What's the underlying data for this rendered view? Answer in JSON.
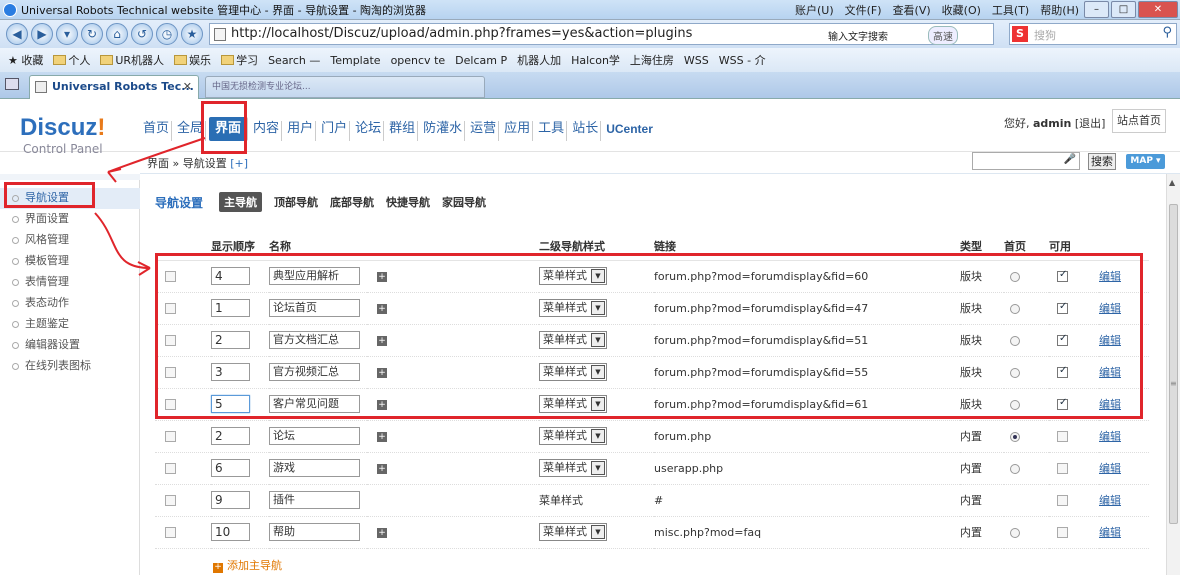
{
  "browser": {
    "title": "Universal Robots Technical website 管理中心 - 界面 - 导航设置 - 陶淘的浏览器",
    "menu": [
      "账户(U)",
      "文件(F)",
      "查看(V)",
      "收藏(O)",
      "工具(T)",
      "帮助(H)"
    ],
    "url": "http://localhost/Discuz/upload/admin.php?frames=yes&action=plugins",
    "ime_hint": "输入文字搜索",
    "speed_label": "高速",
    "search_placeholder": "搜狗",
    "bookmarks": [
      "收藏",
      "个人",
      "UR机器人",
      "娱乐",
      "学习",
      "Search —",
      "Template",
      "opencv te",
      "Delcam P",
      "机器人加",
      "Halcon学",
      "上海住房",
      "WSS",
      "WSS - 介"
    ],
    "tab_title": "Universal Robots Tec...",
    "tab2_title": "中国无损检测专业论坛..."
  },
  "header": {
    "logo_main": "Discuz",
    "logo_bang": "!",
    "logo_sub": "Control Panel",
    "nav": [
      "首页",
      "全局",
      "界面",
      "内容",
      "用户",
      "门户",
      "论坛",
      "群组",
      "防灌水",
      "运营",
      "应用",
      "工具",
      "站长",
      "UCenter"
    ],
    "active_nav": "界面",
    "greeting": "您好,",
    "username": "admin",
    "logout": "[退出]",
    "site_home": "站点首页"
  },
  "crumb": {
    "path": "界面 » 导航设置",
    "plus": "[+]",
    "search_button": "搜索",
    "map_button": "MAP ▾"
  },
  "sidebar": {
    "items": [
      "导航设置",
      "界面设置",
      "风格管理",
      "模板管理",
      "表情管理",
      "表态动作",
      "主题鉴定",
      "编辑器设置",
      "在线列表图标"
    ],
    "active": "导航设置"
  },
  "main": {
    "heading": "导航设置",
    "tabs": [
      "主导航",
      "顶部导航",
      "底部导航",
      "快捷导航",
      "家园导航"
    ],
    "active_tab": "主导航",
    "columns": [
      "",
      "显示顺序",
      "名称",
      "",
      "二级导航样式",
      "链接",
      "类型",
      "首页",
      "可用",
      ""
    ],
    "rows": [
      {
        "order": "4",
        "name": "典型应用解析",
        "style": "菜单样式",
        "link": "forum.php?mod=forumdisplay&fid=60",
        "type": "版块",
        "home": false,
        "enabled": true,
        "edit": "编辑"
      },
      {
        "order": "1",
        "name": "论坛首页",
        "style": "菜单样式",
        "link": "forum.php?mod=forumdisplay&fid=47",
        "type": "版块",
        "home": false,
        "enabled": true,
        "edit": "编辑"
      },
      {
        "order": "2",
        "name": "官方文档汇总",
        "style": "菜单样式",
        "link": "forum.php?mod=forumdisplay&fid=51",
        "type": "版块",
        "home": false,
        "enabled": true,
        "edit": "编辑"
      },
      {
        "order": "3",
        "name": "官方视频汇总",
        "style": "菜单样式",
        "link": "forum.php?mod=forumdisplay&fid=55",
        "type": "版块",
        "home": false,
        "enabled": true,
        "edit": "编辑"
      },
      {
        "order": "5",
        "name": "客户常见问题",
        "style": "菜单样式",
        "link": "forum.php?mod=forumdisplay&fid=61",
        "type": "版块",
        "home": false,
        "enabled": true,
        "edit": "编辑"
      },
      {
        "order": "2",
        "name": "论坛",
        "style": "菜单样式",
        "link": "forum.php",
        "type": "内置",
        "home": true,
        "enabled": false,
        "edit": "编辑"
      },
      {
        "order": "6",
        "name": "游戏",
        "style": "菜单样式",
        "link": "userapp.php",
        "type": "内置",
        "home": false,
        "enabled": false,
        "edit": "编辑"
      },
      {
        "order": "9",
        "name": "插件",
        "style": "菜单样式",
        "link": "#",
        "type": "内置",
        "home": null,
        "enabled": false,
        "edit": "编辑"
      },
      {
        "order": "10",
        "name": "帮助",
        "style": "菜单样式",
        "link": "misc.php?mod=faq",
        "type": "内置",
        "home": false,
        "enabled": false,
        "edit": "编辑"
      }
    ],
    "add_main_nav": "添加主导航"
  },
  "colors": {
    "accent": "#2d6fbc",
    "active_nav_bg": "#2a6eb4",
    "annotation_red": "#e0252b",
    "add_orange": "#e07700"
  }
}
